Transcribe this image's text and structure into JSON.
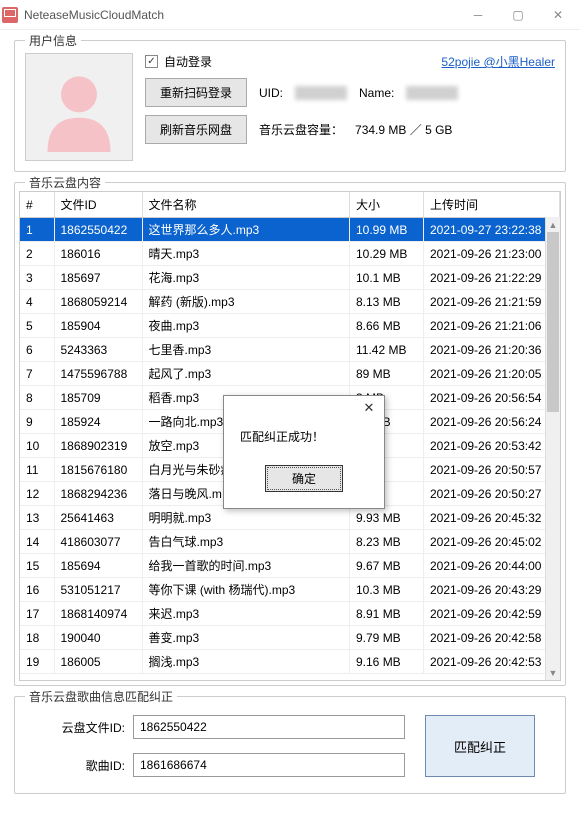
{
  "window": {
    "title": "NeteaseMusicCloudMatch"
  },
  "user_info": {
    "legend": "用户信息",
    "auto_login_label": "自动登录",
    "auto_login_checked": true,
    "link_text": "52pojie @小黑Healer",
    "rescan_btn": "重新扫码登录",
    "refresh_btn": "刷新音乐网盘",
    "uid_label": "UID:",
    "name_label": "Name:",
    "capacity_label": "音乐云盘容量：",
    "capacity_value": "734.9 MB ／ 5 GB"
  },
  "cloud_content": {
    "legend": "音乐云盘内容",
    "columns": {
      "idx": "#",
      "file_id": "文件ID",
      "name": "文件名称",
      "size": "大小",
      "time": "上传时间"
    },
    "rows": [
      {
        "idx": "1",
        "file_id": "1862550422",
        "name": "这世界那么多人.mp3",
        "size": "10.99 MB",
        "time": "2021-09-27 23:22:38",
        "selected": true
      },
      {
        "idx": "2",
        "file_id": "186016",
        "name": "晴天.mp3",
        "size": "10.29 MB",
        "time": "2021-09-26 21:23:00"
      },
      {
        "idx": "3",
        "file_id": "185697",
        "name": "花海.mp3",
        "size": "10.1 MB",
        "time": "2021-09-26 21:22:29"
      },
      {
        "idx": "4",
        "file_id": "1868059214",
        "name": "解药 (新版).mp3",
        "size": "8.13 MB",
        "time": "2021-09-26 21:21:59"
      },
      {
        "idx": "5",
        "file_id": "185904",
        "name": "夜曲.mp3",
        "size": "8.66 MB",
        "time": "2021-09-26 21:21:06"
      },
      {
        "idx": "6",
        "file_id": "5243363",
        "name": "七里香.mp3",
        "size": "11.42 MB",
        "time": "2021-09-26 21:20:36"
      },
      {
        "idx": "7",
        "file_id": "1475596788",
        "name": "起风了.mp3",
        "size": "89 MB",
        "time": "2021-09-26 21:20:05"
      },
      {
        "idx": "8",
        "file_id": "185709",
        "name": "稻香.mp3",
        "size": "3 MB",
        "time": "2021-09-26 20:56:54"
      },
      {
        "idx": "9",
        "file_id": "185924",
        "name": "一路向北.mp3",
        "size": "28 MB",
        "time": "2021-09-26 20:56:24"
      },
      {
        "idx": "10",
        "file_id": "1868902319",
        "name": "放空.mp3",
        "size": "5 MB",
        "time": "2021-09-26 20:53:42"
      },
      {
        "idx": "11",
        "file_id": "1815676180",
        "name": "白月光与朱砂痣",
        "size": "9 MB",
        "time": "2021-09-26 20:50:57"
      },
      {
        "idx": "12",
        "file_id": "1868294236",
        "name": "落日与晚风.m",
        "size": "8 MB",
        "time": "2021-09-26 20:50:27"
      },
      {
        "idx": "13",
        "file_id": "25641463",
        "name": "明明就.mp3",
        "size": "9.93 MB",
        "time": "2021-09-26 20:45:32"
      },
      {
        "idx": "14",
        "file_id": "418603077",
        "name": "告白气球.mp3",
        "size": "8.23 MB",
        "time": "2021-09-26 20:45:02"
      },
      {
        "idx": "15",
        "file_id": "185694",
        "name": "给我一首歌的时间.mp3",
        "size": "9.67 MB",
        "time": "2021-09-26 20:44:00"
      },
      {
        "idx": "16",
        "file_id": "531051217",
        "name": "等你下课 (with 杨瑞代).mp3",
        "size": "10.3 MB",
        "time": "2021-09-26 20:43:29"
      },
      {
        "idx": "17",
        "file_id": "1868140974",
        "name": "来迟.mp3",
        "size": "8.91 MB",
        "time": "2021-09-26 20:42:59"
      },
      {
        "idx": "18",
        "file_id": "190040",
        "name": "善变.mp3",
        "size": "9.79 MB",
        "time": "2021-09-26 20:42:58"
      },
      {
        "idx": "19",
        "file_id": "186005",
        "name": "搁浅.mp3",
        "size": "9.16 MB",
        "time": "2021-09-26 20:42:53"
      }
    ]
  },
  "match": {
    "legend": "音乐云盘歌曲信息匹配纠正",
    "file_id_label": "云盘文件ID:",
    "file_id_value": "1862550422",
    "song_id_label": "歌曲ID:",
    "song_id_value": "1861686674",
    "submit_btn": "匹配纠正"
  },
  "dialog": {
    "message": "匹配纠正成功！",
    "ok_btn": "确定"
  }
}
